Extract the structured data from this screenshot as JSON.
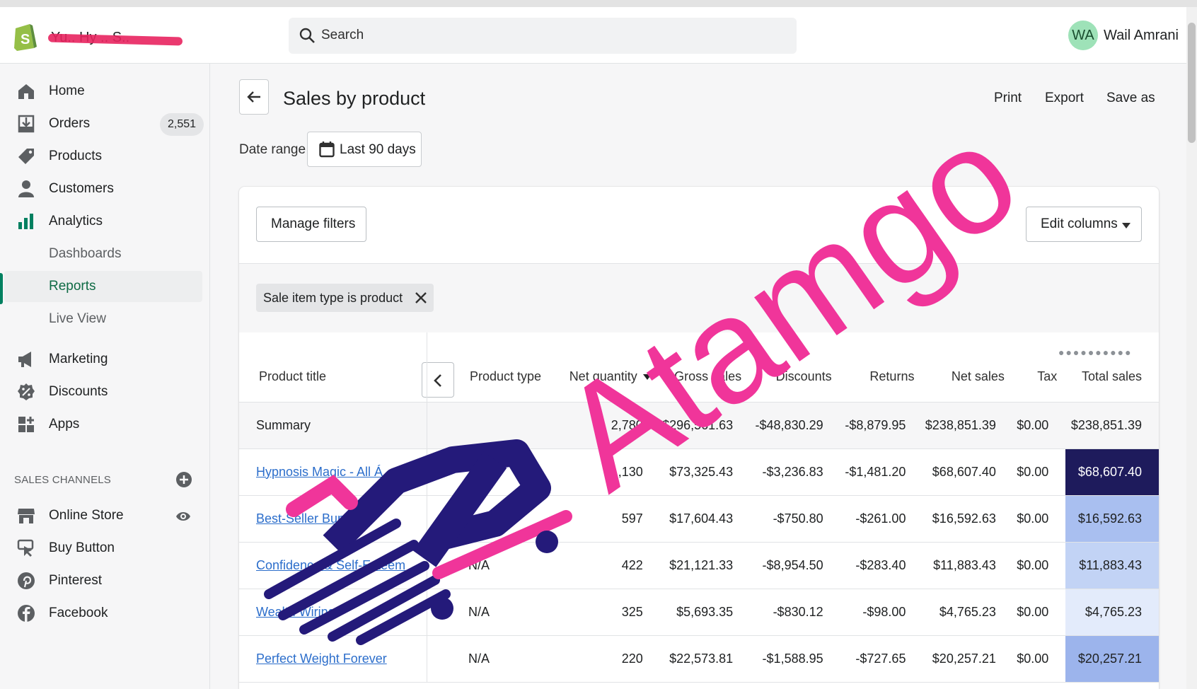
{
  "topbar": {
    "store_name": "Yu..  Hy  .. S..",
    "search_placeholder": "Search",
    "avatar_initials": "WA",
    "user_name": "Wail Amrani"
  },
  "sidebar": {
    "items": [
      {
        "label": "Home",
        "icon": "home-icon"
      },
      {
        "label": "Orders",
        "icon": "orders-icon",
        "badge": "2,551"
      },
      {
        "label": "Products",
        "icon": "tag-icon"
      },
      {
        "label": "Customers",
        "icon": "person-icon"
      },
      {
        "label": "Analytics",
        "icon": "bar-chart-icon"
      },
      {
        "label": "Dashboards"
      },
      {
        "label": "Reports",
        "active": true
      },
      {
        "label": "Live View"
      },
      {
        "label": "Marketing",
        "icon": "megaphone-icon"
      },
      {
        "label": "Discounts",
        "icon": "discount-icon"
      },
      {
        "label": "Apps",
        "icon": "apps-icon"
      }
    ],
    "channels_title": "SALES CHANNELS",
    "channels": [
      {
        "label": "Online Store",
        "icon": "store-icon"
      },
      {
        "label": "Buy Button",
        "icon": "buy-button-icon"
      },
      {
        "label": "Pinterest",
        "icon": "pinterest-icon"
      },
      {
        "label": "Facebook",
        "icon": "facebook-icon"
      }
    ]
  },
  "page": {
    "title": "Sales by product",
    "actions": [
      "Print",
      "Export",
      "Save as"
    ],
    "date_range_label": "Date range",
    "date_range_value": "Last 90 days",
    "manage_filters": "Manage filters",
    "edit_columns": "Edit columns",
    "filter_tag": "Sale item type is product"
  },
  "table": {
    "columns": [
      "Product title",
      "Product type",
      "Net quantity",
      "Gross sales",
      "Discounts",
      "Returns",
      "Net sales",
      "Tax",
      "Total sales"
    ],
    "summary": {
      "label": "Summary",
      "net_quantity": "2,780",
      "gross_sales": "$296,561.63",
      "discounts": "-$48,830.29",
      "returns": "-$8,879.95",
      "net_sales": "$238,851.39",
      "tax": "$0.00",
      "total_sales": "$238,851.39"
    },
    "rows": [
      {
        "title": "Hypnosis Magic - All Á...",
        "type": "",
        "net_quantity": "1,130",
        "gross_sales": "$73,325.43",
        "discounts": "-$3,236.83",
        "returns": "-$1,481.20",
        "net_sales": "$68,607.40",
        "tax": "$0.00",
        "total_sales": "$68,607.40",
        "heat": "#1e1b5c",
        "heat_text": "#ffffff"
      },
      {
        "title": "Best-Seller Bundle",
        "type": "",
        "net_quantity": "597",
        "gross_sales": "$17,604.43",
        "discounts": "-$750.80",
        "returns": "-$261.00",
        "net_sales": "$16,592.63",
        "tax": "$0.00",
        "total_sales": "$16,592.63",
        "heat": "#a9bff0",
        "heat_text": "#202223"
      },
      {
        "title": "Confidence & Self-Esteem",
        "type": "N/A",
        "net_quantity": "422",
        "gross_sales": "$21,121.33",
        "discounts": "-$8,954.50",
        "returns": "-$283.40",
        "net_sales": "$11,883.43",
        "tax": "$0.00",
        "total_sales": "$11,883.43",
        "heat": "#c2d3f5",
        "heat_text": "#202223"
      },
      {
        "title": "Wealth Wiring",
        "type": "N/A",
        "net_quantity": "325",
        "gross_sales": "$5,693.35",
        "discounts": "-$830.12",
        "returns": "-$98.00",
        "net_sales": "$4,765.23",
        "tax": "$0.00",
        "total_sales": "$4,765.23",
        "heat": "#e3ebfb",
        "heat_text": "#202223"
      },
      {
        "title": "Perfect Weight Forever",
        "type": "N/A",
        "net_quantity": "220",
        "gross_sales": "$22,573.81",
        "discounts": "-$1,588.95",
        "returns": "-$727.65",
        "net_sales": "$20,257.21",
        "tax": "$0.00",
        "total_sales": "$20,257.21",
        "heat": "#9cb4ec",
        "heat_text": "#202223"
      }
    ]
  },
  "watermark": {
    "text": "Atamgo",
    "pink": "#f0359a",
    "navy": "#241a7a"
  }
}
